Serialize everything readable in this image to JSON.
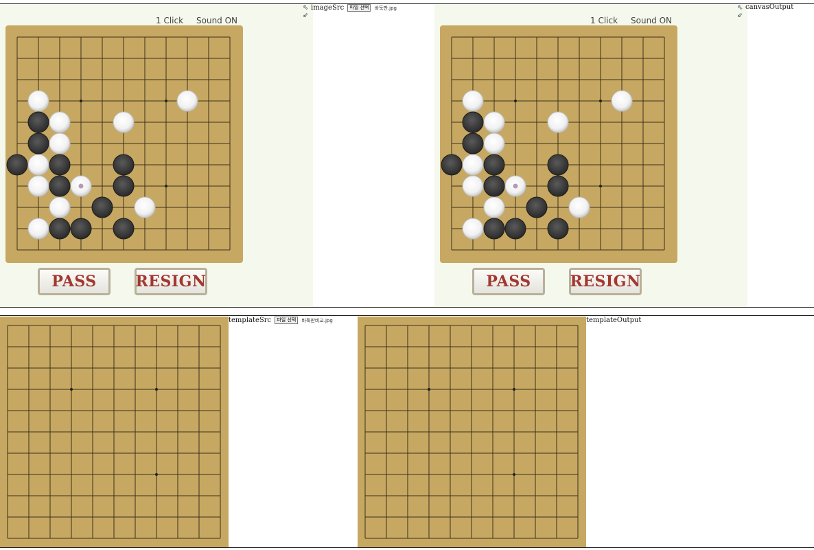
{
  "game": {
    "size": 11,
    "star_points": [
      [
        3,
        3
      ],
      [
        7,
        3
      ],
      [
        7,
        7
      ]
    ],
    "stones": [
      {
        "c": 1,
        "r": 3,
        "color": "white"
      },
      {
        "c": 8,
        "r": 3,
        "color": "white"
      },
      {
        "c": 1,
        "r": 4,
        "color": "black"
      },
      {
        "c": 2,
        "r": 4,
        "color": "white"
      },
      {
        "c": 5,
        "r": 4,
        "color": "white"
      },
      {
        "c": 1,
        "r": 5,
        "color": "black"
      },
      {
        "c": 2,
        "r": 5,
        "color": "white"
      },
      {
        "c": 0,
        "r": 6,
        "color": "black"
      },
      {
        "c": 1,
        "r": 6,
        "color": "white"
      },
      {
        "c": 2,
        "r": 6,
        "color": "black"
      },
      {
        "c": 5,
        "r": 6,
        "color": "black"
      },
      {
        "c": 1,
        "r": 7,
        "color": "white"
      },
      {
        "c": 2,
        "r": 7,
        "color": "black"
      },
      {
        "c": 3,
        "r": 7,
        "color": "white",
        "last_move": true
      },
      {
        "c": 5,
        "r": 7,
        "color": "black"
      },
      {
        "c": 2,
        "r": 8,
        "color": "white"
      },
      {
        "c": 4,
        "r": 8,
        "color": "black"
      },
      {
        "c": 6,
        "r": 8,
        "color": "white"
      },
      {
        "c": 1,
        "r": 9,
        "color": "white"
      },
      {
        "c": 2,
        "r": 9,
        "color": "black"
      },
      {
        "c": 3,
        "r": 9,
        "color": "black"
      },
      {
        "c": 5,
        "r": 9,
        "color": "black"
      }
    ]
  },
  "panels": [
    {
      "click_label": "1 Click",
      "sound_label": "Sound ON",
      "pass_label": "PASS",
      "resign_label": "RESIGN"
    },
    {
      "click_label": "1 Click",
      "sound_label": "Sound ON",
      "pass_label": "PASS",
      "resign_label": "RESIGN"
    }
  ],
  "labels": {
    "image_src": "imageSrc",
    "canvas_output": "canvasOutput",
    "template_src": "templateSrc",
    "template_output": "templateOutput",
    "file_button": "파일 선택",
    "image_file": "바둑판.jpg",
    "template_file": "바둑판비교.jpg"
  },
  "colors": {
    "board": "#c7a862",
    "panel": "#f5f8ec",
    "button_text": "#a2382f",
    "grid_line": "#3b2f1a"
  }
}
